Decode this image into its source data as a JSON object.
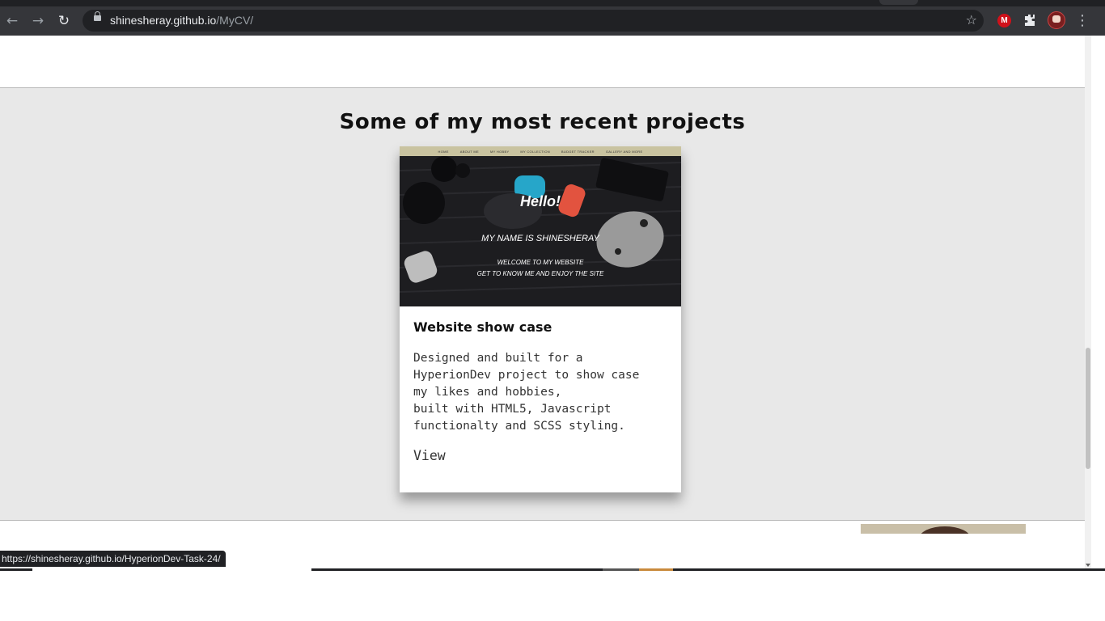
{
  "browser": {
    "url_host": "shinesheray.github.io",
    "url_path": "/MyCV/",
    "icons": {
      "back": "back-arrow-icon",
      "forward": "forward-arrow-icon",
      "reload": "reload-icon",
      "lock": "lock-icon",
      "bookmark": "star-icon",
      "extension_m": "mega-extension-icon",
      "extensions": "puzzle-icon",
      "profile": "profile-avatar-icon",
      "menu": "kebab-menu-icon"
    },
    "extension_m_letter": "M",
    "status_url": "https://shinesheray.github.io/HyperionDev-Task-24/"
  },
  "projects": {
    "heading": "Some of my most recent projects",
    "cards": [
      {
        "thumbnail": {
          "nav": [
            "HOME",
            "ABOUT ME",
            "MY HOBBY",
            "MY COLLECTION",
            "BUDGET TRACKER",
            "GALLERY AND MORE"
          ],
          "hello": "Hello!",
          "name_line": "MY NAME IS SHINESHERAY",
          "sub_line1": "WELCOME TO MY WEBSITE",
          "sub_line2": "GET TO KNOW ME AND ENJOY THE SITE"
        },
        "title": "Website show case",
        "description": "Designed and built for a\nHyperionDev project to show case\nmy likes and hobbies,\nbuilt with HTML5, Javascript\nfunctionalty and SCSS styling.",
        "link_label": "View"
      }
    ]
  },
  "colors": {
    "toolbar_bg": "#35363a",
    "omnibox_bg": "#202124",
    "section_bg": "#e8e8e8",
    "card_bg": "#ffffff",
    "thumb_nav_bg": "#c9c3a0"
  }
}
